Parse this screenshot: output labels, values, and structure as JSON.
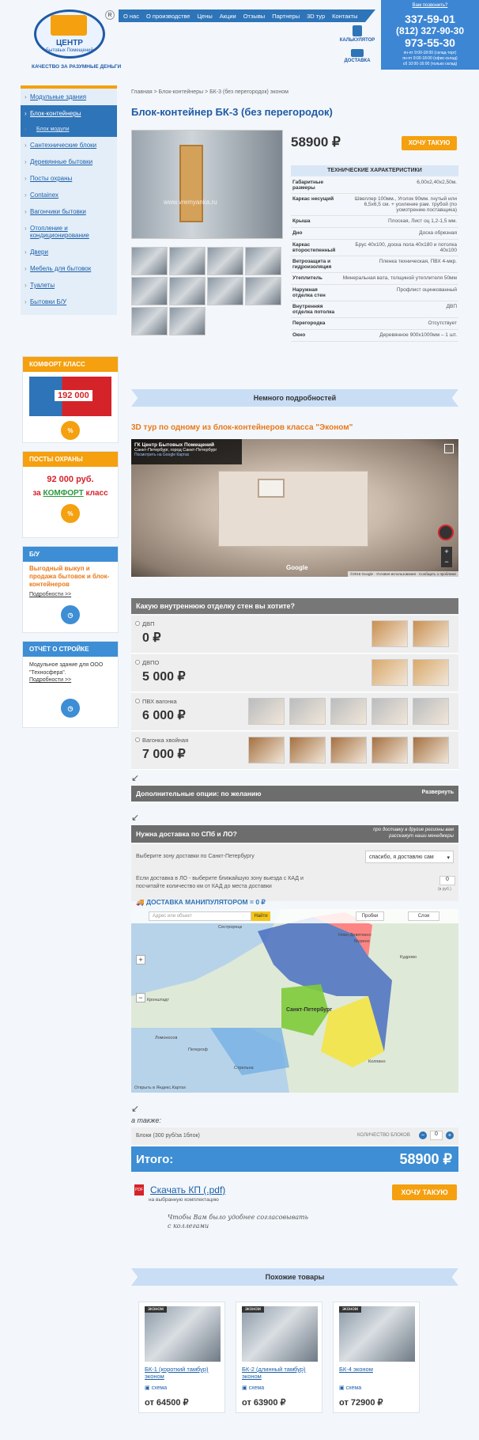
{
  "header": {
    "logo_top": "ЦЕНТР",
    "logo_sub": "Бытовых Помещений",
    "slogan": "КАЧЕСТВО ЗА РАЗУМНЫЕ ДЕНЬГИ",
    "nav": [
      "О нас",
      "О производстве",
      "Цены",
      "Акции",
      "Отзывы",
      "Партнеры",
      "3D тур",
      "Контакты"
    ],
    "calc_label": "КАЛЬКУЛЯТОР",
    "delivery_label": "ДОСТАВКА",
    "callback": "Вам позвонить?",
    "phones": [
      "337-59-01",
      "(812) 327-90-30",
      "973-55-30"
    ],
    "hours": "пн-пт 9:00-18:00 (склад-торг)\nпн-пт 9:00-18:00 (офис-склад)\nсб 10:00-16:00 (только склад)"
  },
  "sidebar": {
    "items": [
      {
        "label": "Модульные здания",
        "active": false
      },
      {
        "label": "Блок-контейнеры",
        "active": true
      },
      {
        "label": "Блок модули",
        "active": false,
        "sub": true
      },
      {
        "label": "Сантехнические блоки",
        "active": false
      },
      {
        "label": "Деревянные бытовки",
        "active": false
      },
      {
        "label": "Посты охраны",
        "active": false
      },
      {
        "label": "Containex",
        "active": false
      },
      {
        "label": "Вагончики бытовки",
        "active": false
      },
      {
        "label": "Отопление и кондиционирование",
        "active": false
      },
      {
        "label": "Двери",
        "active": false
      },
      {
        "label": "Мебель для бытовок",
        "active": false
      },
      {
        "label": "Туалеты",
        "active": false
      },
      {
        "label": "Бытовки Б/У",
        "active": false
      }
    ],
    "promo_comfort": {
      "title": "КОМФОРТ КЛАСС",
      "price": "192 000"
    },
    "promo_posts": {
      "title": "ПОСТЫ ОХРАНЫ",
      "price": "92 000 руб.",
      "line2_pre": "за",
      "line2_accent": "КОМФОРТ",
      "line2_post": "класс"
    },
    "promo_bu": {
      "title": "Б/У",
      "text": "Выгодный выкуп и продажа бытовок и блок-контейнеров",
      "link": "Подробности >>"
    },
    "promo_report": {
      "title": "ОТЧЁТ О СТРОЙКЕ",
      "text": "Модульное здание для ООО \"Техносфера\".",
      "link": "Подробности >>"
    }
  },
  "product": {
    "breadcrumb": "Главная > Блок-контейнеры > БК-3 (без перегородок) эконом",
    "title": "Блок-контейнер БК-3 (без перегородок)",
    "price": "58900 ₽",
    "buy_label": "ХОЧУ ТАКУЮ",
    "watermark": "www.vremyanka.ru",
    "spec_title": "ТЕХНИЧЕСКИЕ ХАРАКТЕРИСТИКИ",
    "specs": [
      {
        "k": "Габаритные размеры",
        "v": "6,00х2,40х2,50м."
      },
      {
        "k": "Каркас несущий",
        "v": "Швеллер 100мм., Уголок 90мм. гнутый или 6,5х6,5 см. + усиление рам. трубой (по усмотрению поставщика)"
      },
      {
        "k": "Крыша",
        "v": "Плоская, Лист оц 1,2-1,5 мм."
      },
      {
        "k": "Дно",
        "v": "Доска обрезная"
      },
      {
        "k": "Каркас второстепенный",
        "v": "Брус 40х100, доска пола 40х180 и потолка 40х100"
      },
      {
        "k": "Ветрозащита и гидроизоляция",
        "v": "Пленка техническая, ПВХ 4-мкр."
      },
      {
        "k": "Утеплитель",
        "v": "Минеральная вата, толщиной утеплителя 50мм"
      },
      {
        "k": "Наружная отделка стен",
        "v": "Профлист оцинкованный"
      },
      {
        "k": "Внутренняя отделка потолка",
        "v": "ДВП"
      },
      {
        "k": "Перегородка",
        "v": "Отсутствует"
      },
      {
        "k": "Окно",
        "v": "Деревянное 900х1000мм – 1 шт."
      }
    ]
  },
  "details_ribbon": "Немного подробностей",
  "tour": {
    "heading": "3D тур по одному из блок-контейнеров класса \"Эконом\"",
    "place_title": "ГК Центр Бытовых Помещений",
    "place_addr": "Санкт-Петербург, город Санкт-Петербург",
    "place_link": "Посмотреть на Google Картах",
    "google": "Google",
    "copy": "©2016 Google · Условия использования · Сообщить о проблеме"
  },
  "finish": {
    "question": "Какую внутреннюю отделку стен вы хотите?",
    "options": [
      {
        "label": "ДВП",
        "price": "0 ₽",
        "swatches": 2
      },
      {
        "label": "ДВПО",
        "price": "5 000 ₽",
        "swatches": 2
      },
      {
        "label": "ПВХ вагонка",
        "price": "6 000 ₽",
        "swatches": 5
      },
      {
        "label": "Вагонка хвойная",
        "price": "7 000 ₽",
        "swatches": 5
      }
    ]
  },
  "extra": {
    "label": "Дополнительные опции: по желанию",
    "toggle": "Развернуть"
  },
  "delivery": {
    "question": "Нужна доставка по СПб и ЛО?",
    "note": "про доставку в другие регионы вам расскажут наши менеджеры",
    "zone_text": "Выберите зону доставки по Санкт-Петербургу",
    "zone_value": "спасибо, я доставлю сам",
    "lo_text": "Если доставка в ЛО - выберите ближайшую зону выезда с КАД и посчитайте количество км от КАД до места доставки",
    "km_value": "0",
    "km_unit": "(в руб.)",
    "manip": "ДОСТАВКА МАНИПУЛЯТОРОМ = 0 ₽",
    "map_search_ph": "Адрес или объект",
    "map_find": "Найти",
    "map_traffic": "Пробки",
    "map_layers": "Слои",
    "map_city": "Санкт-Петербург",
    "map_footer": "Открыть в Яндекс.Картах",
    "map_places": [
      "Сестрорецк",
      "Кронштадт",
      "Ломоносов",
      "Петергоф",
      "Стрельна",
      "Колпино",
      "Мурино",
      "Ново-Девяткино",
      "Кудрово"
    ]
  },
  "also": {
    "label": "а также:",
    "item": "Блоки (300 руб/за 1блок)",
    "count_label": "КОЛИЧЕСТВО БЛОКОВ",
    "count": "0"
  },
  "total": {
    "label": "Итого:",
    "value": "58900 ₽"
  },
  "download": {
    "link": "Скачать КП (.pdf)",
    "sub": "на выбранную комплектацию",
    "buy": "ХОЧУ ТАКУЮ",
    "hand": "Чтобы Вам было удобнее согласовывать с коллегами"
  },
  "similar": {
    "title": "Похожие товары",
    "items": [
      {
        "tag": "эконом",
        "name": "БК-1 (короткий тамбур) эконом",
        "scheme": "схема",
        "price": "от 64500 ₽"
      },
      {
        "tag": "эконом",
        "name": "БК-2 (длинный тамбур) эконом",
        "scheme": "схема",
        "price": "от 63900 ₽"
      },
      {
        "tag": "эконом",
        "name": "БК-4 эконом",
        "scheme": "схема",
        "price": "от 72900 ₽"
      }
    ]
  },
  "colors": {
    "brand": "#2e74b8",
    "accent": "#f5a00f",
    "total": "#3d8ed4"
  }
}
